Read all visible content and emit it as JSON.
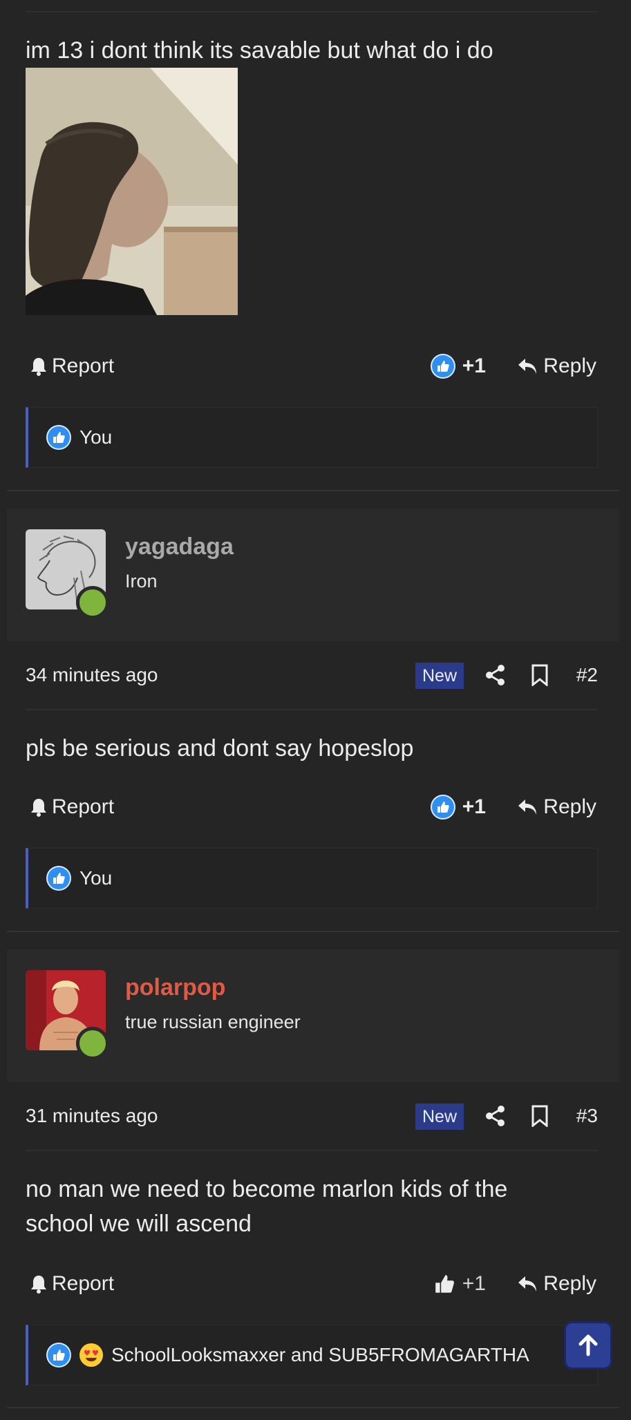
{
  "post1": {
    "text": "im 13 i dont think its savable but what do i do",
    "actions": {
      "report": "Report",
      "like_count": "+1",
      "reply": "Reply"
    },
    "reactions": {
      "users": "You"
    }
  },
  "post2": {
    "user": {
      "name": "yagadaga",
      "title": "Iron",
      "name_color": "#a9a9a9",
      "online": true
    },
    "meta": {
      "time": "34 minutes ago",
      "badge": "New",
      "number": "#2"
    },
    "text": "pls be serious and dont say hopeslop",
    "actions": {
      "report": "Report",
      "like_count": "+1",
      "reply": "Reply"
    },
    "reactions": {
      "users": "You"
    }
  },
  "post3": {
    "user": {
      "name": "polarpop",
      "title": "true russian engineer",
      "name_color": "#e05a45",
      "online": true
    },
    "meta": {
      "time": "31 minutes ago",
      "badge": "New",
      "number": "#3"
    },
    "text_line1": "no man we need to become marlon kids of the",
    "text_line2": "school we will ascend",
    "actions": {
      "report": "Report",
      "like_count": "+1",
      "reply": "Reply"
    },
    "reactions": {
      "users": "SchoolLooksmaxxer and SUB5FROMAGARTHA"
    }
  },
  "icons": {
    "report": "bell-icon",
    "like": "thumbs-up-icon",
    "reply": "reply-arrow-icon",
    "share": "share-icon",
    "bookmark": "bookmark-icon",
    "reaction_love": "heart-eyes-icon",
    "scroll_top": "arrow-up-icon"
  },
  "colors": {
    "accent": "#4c5ec8",
    "badge": "#2b3b8a",
    "online": "#7fb53c",
    "like": "#2f8ff0"
  }
}
